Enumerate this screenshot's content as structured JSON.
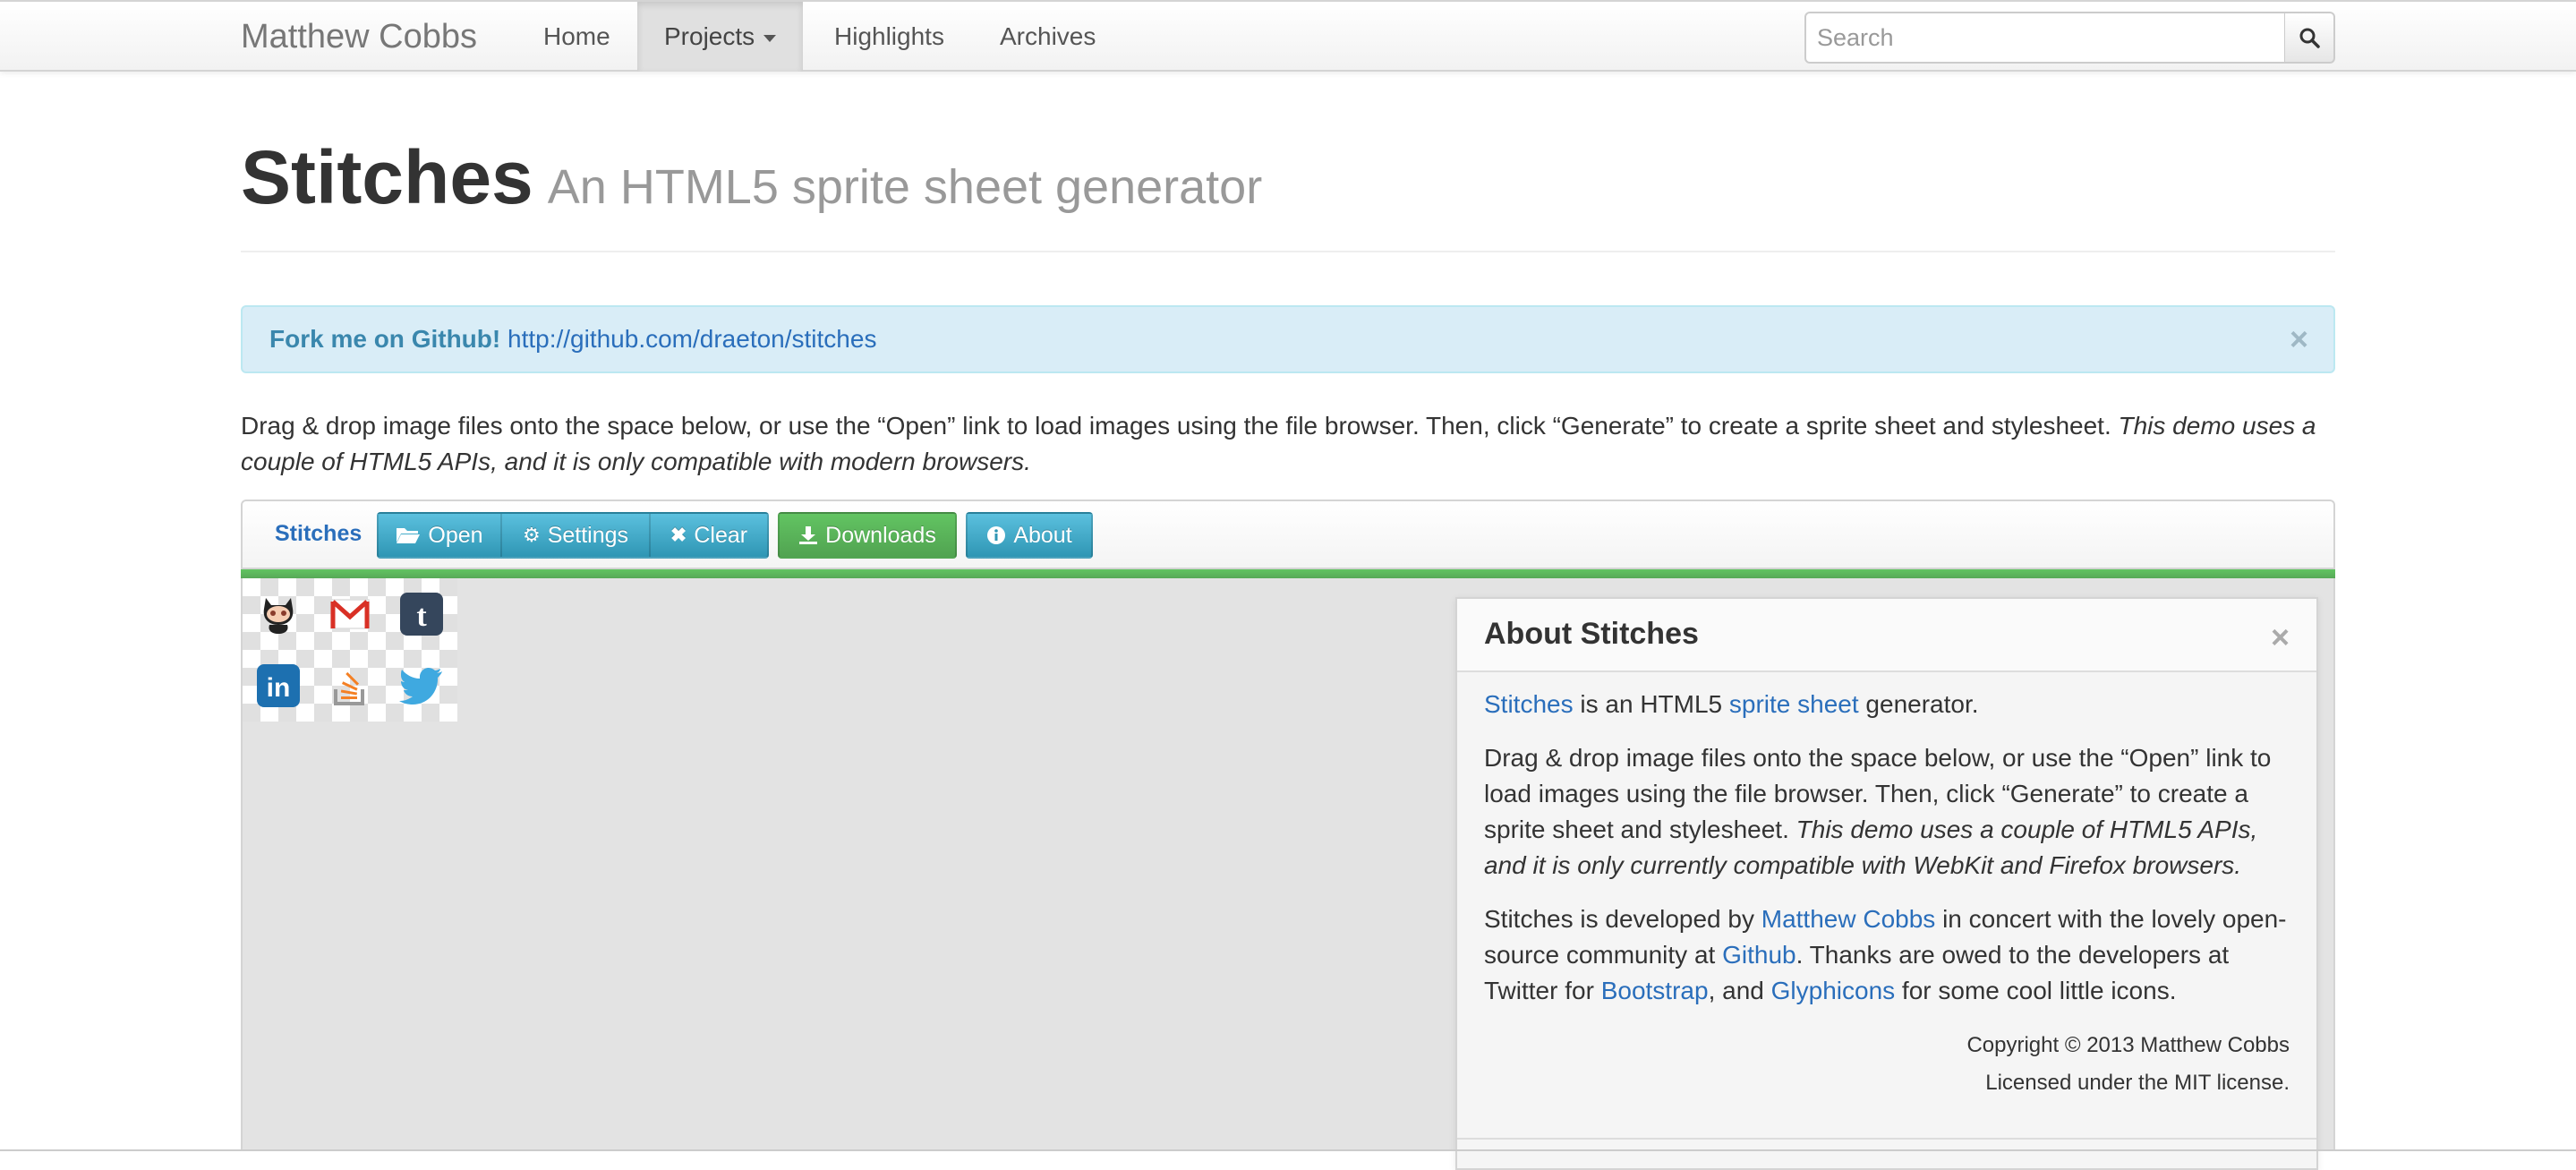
{
  "navbar": {
    "brand": "Matthew Cobbs",
    "items": [
      {
        "label": "Home"
      },
      {
        "label": "Projects"
      },
      {
        "label": "Highlights"
      },
      {
        "label": "Archives"
      }
    ],
    "search_placeholder": "Search"
  },
  "header": {
    "title": "Stitches",
    "subtitle": "An HTML5 sprite sheet generator"
  },
  "alert": {
    "bold": "Fork me on Github!",
    "link": "http://github.com/draeton/stitches",
    "close": "×"
  },
  "intro": {
    "text": "Drag & drop image files onto the space below, or use the “Open” link to load images using the file browser. Then, click “Generate” to create a sprite sheet and stylesheet.",
    "italic": "This demo uses a couple of HTML5 APIs, and it is only compatible with modern browsers."
  },
  "toolbar": {
    "brand": "Stitches",
    "open": "Open",
    "settings": "Settings",
    "clear": "Clear",
    "downloads": "Downloads",
    "about": "About"
  },
  "sprites": [
    {
      "name": "github-octocat-icon"
    },
    {
      "name": "gmail-icon"
    },
    {
      "name": "tumblr-icon"
    },
    {
      "name": "linkedin-icon"
    },
    {
      "name": "stackoverflow-icon"
    },
    {
      "name": "twitter-icon"
    }
  ],
  "about": {
    "title": "About Stitches",
    "close": "×",
    "p1_link1": "Stitches",
    "p1_mid": " is an HTML5 ",
    "p1_link2": "sprite sheet",
    "p1_end": " generator.",
    "p2_text": "Drag & drop image files onto the space below, or use the “Open” link to load images using the file browser. Then, click “Generate” to create a sprite sheet and stylesheet. ",
    "p2_italic": "This demo uses a couple of HTML5 APIs, and it is only currently compatible with WebKit and Firefox browsers.",
    "p3_a": "Stitches is developed by ",
    "p3_link1": "Matthew Cobbs",
    "p3_b": " in concert with the lovely open-source community at ",
    "p3_link2": "Github",
    "p3_c": ". Thanks are owed to the developers at Twitter for ",
    "p3_link3": "Bootstrap",
    "p3_d": ", and ",
    "p3_link4": "Glyphicons",
    "p3_e": " for some cool little icons.",
    "copyright": "Copyright © 2013 Matthew Cobbs",
    "license": "Licensed under the MIT license."
  },
  "colors": {
    "link": "#2a6ebb",
    "info_button": "#2f96b4",
    "success_button": "#51a351",
    "alert_bg": "#d9edf7"
  }
}
